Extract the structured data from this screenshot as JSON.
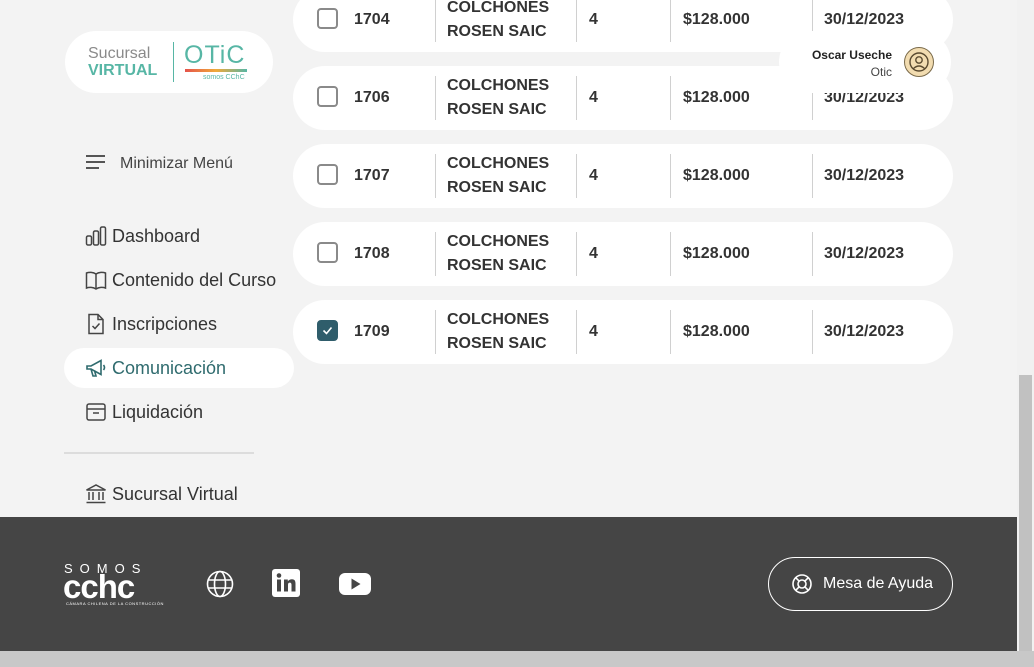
{
  "brand": {
    "sucursal": "Sucursal",
    "virtual": "VIRTUAL",
    "otic": "OTiC",
    "otic_sub": "somos CChC"
  },
  "sidebar": {
    "minimize_label": "Minimizar Menú",
    "items": [
      {
        "label": "Dashboard",
        "icon": "bar-chart-icon",
        "active": false
      },
      {
        "label": "Contenido del Curso",
        "icon": "book-icon",
        "active": false
      },
      {
        "label": "Inscripciones",
        "icon": "file-check-icon",
        "active": false
      },
      {
        "label": "Comunicación",
        "icon": "megaphone-icon",
        "active": true
      },
      {
        "label": "Liquidación",
        "icon": "archive-icon",
        "active": false
      },
      {
        "label": "Sucursal Virtual",
        "icon": "bank-icon",
        "active": false
      }
    ]
  },
  "user": {
    "name": "Oscar Useche",
    "role": "Otic"
  },
  "table": {
    "rows": [
      {
        "checked": false,
        "id": "1704",
        "name_line1": "COLCHONES",
        "name_line2": "ROSEN SAIC",
        "qty": "4",
        "amount": "$128.000",
        "date": "30/12/2023"
      },
      {
        "checked": false,
        "id": "1706",
        "name_line1": "COLCHONES",
        "name_line2": "ROSEN SAIC",
        "qty": "4",
        "amount": "$128.000",
        "date": "30/12/2023"
      },
      {
        "checked": false,
        "id": "1707",
        "name_line1": "COLCHONES",
        "name_line2": "ROSEN SAIC",
        "qty": "4",
        "amount": "$128.000",
        "date": "30/12/2023"
      },
      {
        "checked": false,
        "id": "1708",
        "name_line1": "COLCHONES",
        "name_line2": "ROSEN SAIC",
        "qty": "4",
        "amount": "$128.000",
        "date": "30/12/2023"
      },
      {
        "checked": true,
        "id": "1709",
        "name_line1": "COLCHONES",
        "name_line2": "ROSEN SAIC",
        "qty": "4",
        "amount": "$128.000",
        "date": "30/12/2023"
      }
    ]
  },
  "footer": {
    "somos": "SOMOS",
    "cchc": "cchc",
    "cchc_sub": "CÁMARA CHILENA DE LA CONSTRUCCIÓN",
    "social": [
      "globe-icon",
      "linkedin-icon",
      "youtube-icon"
    ],
    "help_label": "Mesa de Ayuda"
  },
  "colors": {
    "accent": "#2f6b6e",
    "brand_green": "#57b6a5",
    "footer_bg": "#454545",
    "checkbox_checked": "#2f5d6b"
  }
}
